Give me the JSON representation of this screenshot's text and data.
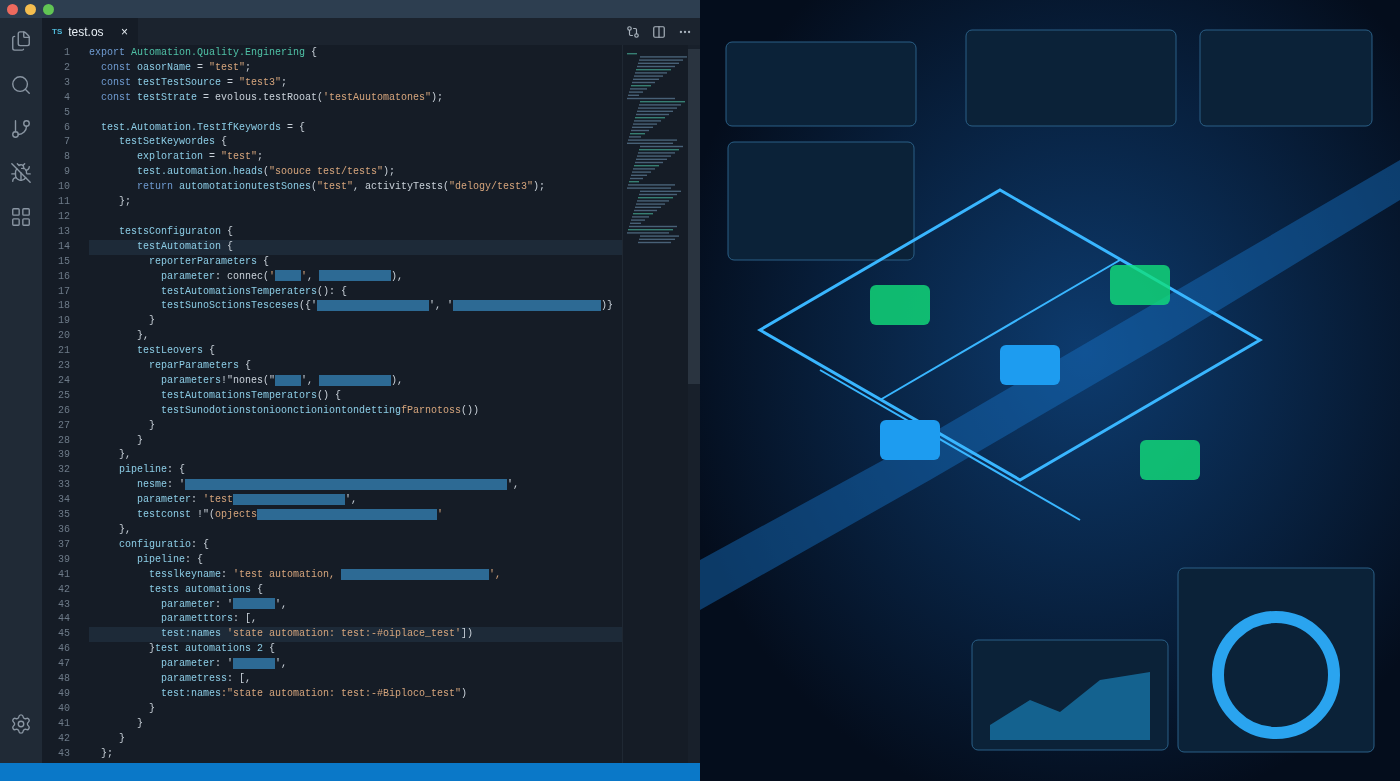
{
  "tabs": [
    {
      "badge": "TS",
      "label": "test.os",
      "close": "×",
      "selected": true
    }
  ],
  "editor": {
    "lines": [
      {
        "number": "1",
        "highlighted": false,
        "tokens": [
          {
            "kind": "keyword",
            "text": "export "
          },
          {
            "kind": "type",
            "text": "Automation.Quality.Enginering"
          },
          {
            "kind": "punct",
            "text": " {"
          }
        ]
      },
      {
        "number": "2",
        "highlighted": false,
        "tokens": [
          {
            "kind": "keyword",
            "text": "  const "
          },
          {
            "kind": "name",
            "text": "oasorName"
          },
          {
            "kind": "punct",
            "text": " = "
          },
          {
            "kind": "string",
            "text": "\"test\""
          },
          {
            "kind": "punct",
            "text": ";"
          }
        ]
      },
      {
        "number": "3",
        "highlighted": false,
        "tokens": [
          {
            "kind": "keyword",
            "text": "  const "
          },
          {
            "kind": "name",
            "text": "testTestSource"
          },
          {
            "kind": "punct",
            "text": " = "
          },
          {
            "kind": "string",
            "text": "\"test3\""
          },
          {
            "kind": "punct",
            "text": ";"
          }
        ]
      },
      {
        "number": "4",
        "highlighted": false,
        "tokens": [
          {
            "kind": "keyword",
            "text": "  const "
          },
          {
            "kind": "name",
            "text": "testStrate"
          },
          {
            "kind": "punct",
            "text": " = evolous.testRooat("
          },
          {
            "kind": "string",
            "text": "'testAuutomatones\""
          },
          {
            "kind": "punct",
            "text": ");"
          }
        ]
      },
      {
        "number": "5",
        "highlighted": false
      },
      {
        "number": "6",
        "highlighted": false,
        "tokens": [
          {
            "kind": "name",
            "text": "  test.Automation.TestIfKeywords"
          },
          {
            "kind": "punct",
            "text": " = {"
          }
        ]
      },
      {
        "number": "7",
        "highlighted": false,
        "tokens": [
          {
            "kind": "name",
            "text": "     testSetKeywordes"
          },
          {
            "kind": "punct",
            "text": " {"
          }
        ]
      },
      {
        "number": "8",
        "highlighted": false,
        "tokens": [
          {
            "kind": "name",
            "text": "        exploration"
          },
          {
            "kind": "punct",
            "text": " = "
          },
          {
            "kind": "string",
            "text": "\"test\""
          },
          {
            "kind": "punct",
            "text": ";"
          }
        ]
      },
      {
        "number": "9",
        "highlighted": false,
        "tokens": [
          {
            "kind": "name",
            "text": "        test.automation.heads"
          },
          {
            "kind": "punct",
            "text": "("
          },
          {
            "kind": "string",
            "text": "\"soouce test/tests\""
          },
          {
            "kind": "punct",
            "text": ");"
          }
        ]
      },
      {
        "number": "10",
        "highlighted": false,
        "tokens": [
          {
            "kind": "keyword",
            "text": "        return "
          },
          {
            "kind": "name",
            "text": "automotationutestSones"
          },
          {
            "kind": "punct",
            "text": "("
          },
          {
            "kind": "string",
            "text": "\"test\""
          },
          {
            "kind": "punct",
            "text": ", activityTests("
          },
          {
            "kind": "string",
            "text": "\"delogy/test3\""
          },
          {
            "kind": "punct",
            "text": ");"
          }
        ]
      },
      {
        "number": "11",
        "highlighted": false,
        "tokens": [
          {
            "kind": "punct",
            "text": "     };"
          }
        ]
      },
      {
        "number": "12",
        "highlighted": false
      },
      {
        "number": "13",
        "highlighted": false,
        "tokens": [
          {
            "kind": "name",
            "text": "     testsConfiguraton"
          },
          {
            "kind": "punct",
            "text": " {"
          }
        ]
      },
      {
        "number": "14",
        "highlighted": true,
        "tokens": [
          {
            "kind": "name",
            "text": "        testAutomation"
          },
          {
            "kind": "punct",
            "text": " {"
          }
        ]
      },
      {
        "number": "15",
        "highlighted": false,
        "tokens": [
          {
            "kind": "name",
            "text": "          reporterParameters"
          },
          {
            "kind": "punct",
            "text": " {"
          }
        ]
      },
      {
        "number": "16",
        "highlighted": false,
        "tokens": [
          {
            "kind": "name",
            "text": "            parameter"
          },
          {
            "kind": "punct",
            "text": ": connec("
          },
          {
            "kind": "string",
            "text": "'"
          },
          {
            "kind": "tinyblot"
          },
          {
            "kind": "string",
            "text": "'"
          },
          {
            "kind": "punct",
            "text": ", "
          },
          {
            "kind": "midblot"
          },
          {
            "kind": "punct",
            "text": "),"
          }
        ]
      },
      {
        "number": "17",
        "highlighted": false,
        "tokens": [
          {
            "kind": "name",
            "text": "            testAutomationsTemperaters"
          },
          {
            "kind": "punct",
            "text": "(): {"
          }
        ]
      },
      {
        "number": "18",
        "highlighted": false,
        "tokens": [
          {
            "kind": "name",
            "text": "            testSunoSctionsTesceses"
          },
          {
            "kind": "punct",
            "text": "({'"
          },
          {
            "kind": "largeblot"
          },
          {
            "kind": "punct",
            "text": "', '"
          },
          {
            "kind": "wideblot"
          },
          {
            "kind": "punct",
            "text": ")}"
          }
        ]
      },
      {
        "number": "19",
        "highlighted": false,
        "tokens": [
          {
            "kind": "punct",
            "text": "          }"
          }
        ]
      },
      {
        "number": "20",
        "highlighted": false,
        "tokens": [
          {
            "kind": "punct",
            "text": "        },"
          }
        ]
      },
      {
        "number": "21",
        "highlighted": false,
        "tokens": [
          {
            "kind": "name",
            "text": "        testLeovers"
          },
          {
            "kind": "punct",
            "text": " {"
          }
        ]
      },
      {
        "number": "23",
        "highlighted": false,
        "tokens": [
          {
            "kind": "name",
            "text": "          reparParameters"
          },
          {
            "kind": "punct",
            "text": " {"
          }
        ]
      },
      {
        "number": "24",
        "highlighted": false,
        "tokens": [
          {
            "kind": "name",
            "text": "            parameters"
          },
          {
            "kind": "punct",
            "text": "!\"nones(\""
          },
          {
            "kind": "tinyblot"
          },
          {
            "kind": "punct",
            "text": "', "
          },
          {
            "kind": "midblot"
          },
          {
            "kind": "punct",
            "text": "),"
          }
        ]
      },
      {
        "number": "25",
        "highlighted": false,
        "tokens": [
          {
            "kind": "name",
            "text": "            testAutomationsTemperators"
          },
          {
            "kind": "punct",
            "text": "() {"
          }
        ]
      },
      {
        "number": "26",
        "highlighted": false,
        "tokens": [
          {
            "kind": "name",
            "text": "            testSunodotionstonioonctioniontondetting"
          },
          {
            "kind": "string",
            "text": "fParnotoss"
          },
          {
            "kind": "punct",
            "text": "())"
          }
        ]
      },
      {
        "number": "27",
        "highlighted": false,
        "tokens": [
          {
            "kind": "punct",
            "text": "          }"
          }
        ]
      },
      {
        "number": "28",
        "highlighted": false,
        "tokens": [
          {
            "kind": "punct",
            "text": "        }"
          }
        ]
      },
      {
        "number": "39",
        "highlighted": false,
        "tokens": [
          {
            "kind": "punct",
            "text": "     },"
          }
        ]
      },
      {
        "number": "32",
        "highlighted": false,
        "tokens": [
          {
            "kind": "name",
            "text": "     pipeline"
          },
          {
            "kind": "punct",
            "text": ": {"
          }
        ]
      },
      {
        "number": "33",
        "highlighted": false,
        "tokens": [
          {
            "kind": "name",
            "text": "        nesme"
          },
          {
            "kind": "punct",
            "text": ": '"
          },
          {
            "kind": "widestblot"
          },
          {
            "kind": "punct",
            "text": "',"
          }
        ]
      },
      {
        "number": "34",
        "highlighted": false,
        "tokens": [
          {
            "kind": "name",
            "text": "        parameter"
          },
          {
            "kind": "punct",
            "text": ": "
          },
          {
            "kind": "string",
            "text": "'test"
          },
          {
            "kind": "largeblot"
          },
          {
            "kind": "punct",
            "text": "',"
          }
        ]
      },
      {
        "number": "35",
        "highlighted": false,
        "tokens": [
          {
            "kind": "name",
            "text": "        testconst"
          },
          {
            "kind": "punct",
            "text": " !\"("
          },
          {
            "kind": "string",
            "text": "opjects"
          },
          {
            "kind": "widerblot"
          },
          {
            "kind": "string",
            "text": "'"
          }
        ]
      },
      {
        "number": "36",
        "highlighted": false,
        "tokens": [
          {
            "kind": "punct",
            "text": "     },"
          }
        ]
      },
      {
        "number": "37",
        "highlighted": false,
        "tokens": [
          {
            "kind": "name",
            "text": "     configuratio"
          },
          {
            "kind": "punct",
            "text": ": {"
          }
        ]
      },
      {
        "number": "39",
        "highlighted": false,
        "tokens": [
          {
            "kind": "name",
            "text": "        pipeline"
          },
          {
            "kind": "punct",
            "text": ": {"
          }
        ]
      },
      {
        "number": "41",
        "highlighted": false,
        "tokens": [
          {
            "kind": "name",
            "text": "          tesslkeyname"
          },
          {
            "kind": "punct",
            "text": ": "
          },
          {
            "kind": "string",
            "text": "'test automation, "
          },
          {
            "kind": "wideblot"
          },
          {
            "kind": "string",
            "text": "',"
          }
        ]
      },
      {
        "number": "42",
        "highlighted": false,
        "tokens": [
          {
            "kind": "name",
            "text": "          tests automations"
          },
          {
            "kind": "punct",
            "text": " {"
          }
        ]
      },
      {
        "number": "43",
        "highlighted": false,
        "tokens": [
          {
            "kind": "name",
            "text": "            parameter"
          },
          {
            "kind": "punct",
            "text": ": '"
          },
          {
            "kind": "smallblot"
          },
          {
            "kind": "punct",
            "text": "',"
          }
        ]
      },
      {
        "number": "44",
        "highlighted": false,
        "tokens": [
          {
            "kind": "name",
            "text": "            parametttors"
          },
          {
            "kind": "punct",
            "text": ": [,"
          }
        ]
      },
      {
        "number": "45",
        "highlighted": true,
        "tokens": [
          {
            "kind": "name",
            "text": "            test:names"
          },
          {
            "kind": "string",
            "text": " 'state automation: test:-#oiplace_test'"
          },
          {
            "kind": "punct",
            "text": "])"
          }
        ]
      },
      {
        "number": "46",
        "highlighted": false,
        "tokens": [
          {
            "kind": "punct",
            "text": "          }"
          },
          {
            "kind": "name",
            "text": "test automations 2"
          },
          {
            "kind": "punct",
            "text": " {"
          }
        ]
      },
      {
        "number": "47",
        "highlighted": false,
        "tokens": [
          {
            "kind": "name",
            "text": "            parameter"
          },
          {
            "kind": "punct",
            "text": ": '"
          },
          {
            "kind": "smallblot"
          },
          {
            "kind": "punct",
            "text": "',"
          }
        ]
      },
      {
        "number": "48",
        "highlighted": false,
        "tokens": [
          {
            "kind": "name",
            "text": "            parametress"
          },
          {
            "kind": "punct",
            "text": ": [,"
          }
        ]
      },
      {
        "number": "49",
        "highlighted": false,
        "tokens": [
          {
            "kind": "name",
            "text": "            test:names"
          },
          {
            "kind": "string",
            "text": ":\"state automation: test:-#Biploco_test\""
          },
          {
            "kind": "punct",
            "text": ")"
          }
        ]
      },
      {
        "number": "40",
        "highlighted": false,
        "tokens": [
          {
            "kind": "punct",
            "text": "          }"
          }
        ]
      },
      {
        "number": "41",
        "highlighted": false,
        "tokens": [
          {
            "kind": "punct",
            "text": "        }"
          }
        ]
      },
      {
        "number": "42",
        "highlighted": false,
        "tokens": [
          {
            "kind": "punct",
            "text": "     }"
          }
        ]
      },
      {
        "number": "43",
        "highlighted": false,
        "tokens": [
          {
            "kind": "punct",
            "text": "  };"
          }
        ]
      }
    ]
  }
}
